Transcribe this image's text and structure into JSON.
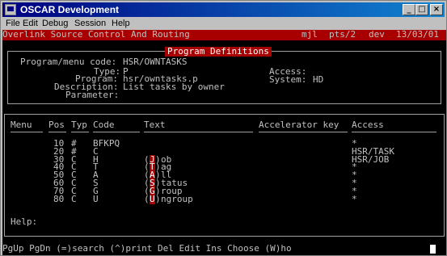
{
  "window": {
    "title": "OSCAR Development"
  },
  "window_buttons": {
    "minimize": "_",
    "maximize": "□",
    "close": "×"
  },
  "menu": [
    "File",
    "Edit",
    "Debug",
    "Session",
    "Help"
  ],
  "status_bar": {
    "title": "Overlink Source Control And Routing",
    "user": "mjl",
    "tty": "pts/2",
    "env": "dev",
    "date": "13/03/01"
  },
  "program_definitions": {
    "heading": "Program Definitions",
    "code_label": "Program/menu code:",
    "code_value": "HSR/OWNTASKS",
    "type_label": "Type:",
    "type_value": "P",
    "program_label": "Program:",
    "program_value": "hsr/owntasks.p",
    "description_label": "Description:",
    "description_value": "List tasks by owner",
    "parameter_label": "Parameter:",
    "parameter_value": "",
    "access_label": "Access:",
    "access_value": "",
    "system_label": "System:",
    "system_value": "HD"
  },
  "table": {
    "headers": {
      "menu": "Menu",
      "pos": "Pos",
      "typ": "Typ",
      "code": "Code",
      "text": "Text",
      "accel": "Accelerator key",
      "access": "Access"
    },
    "rows": [
      {
        "pos": "10",
        "typ": "#",
        "code": "BFKPQ",
        "hot": "",
        "rest": "",
        "access": "*"
      },
      {
        "pos": "20",
        "typ": "#",
        "code": "C",
        "hot": "",
        "rest": "",
        "access": "HSR/TASK"
      },
      {
        "pos": "30",
        "typ": "C",
        "code": "H",
        "hot": "J",
        "rest": "ob",
        "access": "HSR/JOB"
      },
      {
        "pos": "40",
        "typ": "C",
        "code": "T",
        "hot": "T",
        "rest": "ag",
        "access": "*"
      },
      {
        "pos": "50",
        "typ": "C",
        "code": "A",
        "hot": "A",
        "rest": "ll",
        "access": "*"
      },
      {
        "pos": "60",
        "typ": "C",
        "code": "S",
        "hot": "S",
        "rest": "tatus",
        "access": "*"
      },
      {
        "pos": "70",
        "typ": "C",
        "code": "G",
        "hot": "G",
        "rest": "roup",
        "access": "*"
      },
      {
        "pos": "80",
        "typ": "C",
        "code": "U",
        "hot": "U",
        "rest": "ngroup",
        "access": "*"
      }
    ]
  },
  "help": {
    "label": "Help:"
  },
  "keys": "PgUp PgDn (=)search (^)print Del Edit Ins Choose (W)ho"
}
